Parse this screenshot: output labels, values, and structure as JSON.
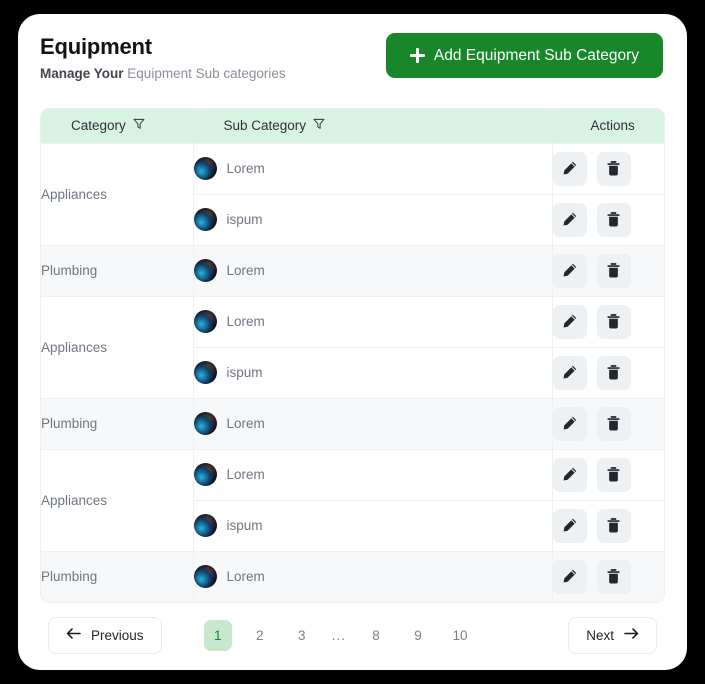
{
  "header": {
    "title": "Equipment",
    "subtitle_lead": "Manage Your",
    "subtitle_rest": "Equipment Sub categories",
    "add_button_label": "Add Equipment Sub Category",
    "add_button_color": "#17872a"
  },
  "table": {
    "columns": [
      {
        "label": "Category",
        "has_filter": true
      },
      {
        "label": "Sub Category",
        "has_filter": true
      },
      {
        "label": "Actions",
        "has_filter": false
      }
    ],
    "header_bg": "#d8f3e2",
    "groups": [
      {
        "category": "Appliances",
        "shaded": false,
        "rows": [
          {
            "sub_category": "Lorem",
            "avatar": "planet-avatar"
          },
          {
            "sub_category": "ispum",
            "avatar": "planet-avatar"
          }
        ]
      },
      {
        "category": "Plumbing",
        "shaded": true,
        "rows": [
          {
            "sub_category": "Lorem",
            "avatar": "planet-avatar"
          }
        ]
      },
      {
        "category": "Appliances",
        "shaded": false,
        "rows": [
          {
            "sub_category": "Lorem",
            "avatar": "planet-avatar"
          },
          {
            "sub_category": "ispum",
            "avatar": "planet-avatar"
          }
        ]
      },
      {
        "category": "Plumbing",
        "shaded": true,
        "rows": [
          {
            "sub_category": "Lorem",
            "avatar": "planet-avatar"
          }
        ]
      },
      {
        "category": "Appliances",
        "shaded": false,
        "rows": [
          {
            "sub_category": "Lorem",
            "avatar": "planet-avatar"
          },
          {
            "sub_category": "ispum",
            "avatar": "planet-avatar"
          }
        ]
      },
      {
        "category": "Plumbing",
        "shaded": true,
        "rows": [
          {
            "sub_category": "Lorem",
            "avatar": "planet-avatar"
          }
        ]
      }
    ],
    "row_actions": [
      {
        "name": "edit",
        "icon": "pencil-icon"
      },
      {
        "name": "delete",
        "icon": "trash-icon"
      }
    ]
  },
  "pagination": {
    "previous_label": "Previous",
    "next_label": "Next",
    "pages": [
      "1",
      "2",
      "3",
      "...",
      "8",
      "9",
      "10"
    ],
    "active_page": "1",
    "active_bg": "#c6e9ce",
    "active_color": "#17872a"
  }
}
